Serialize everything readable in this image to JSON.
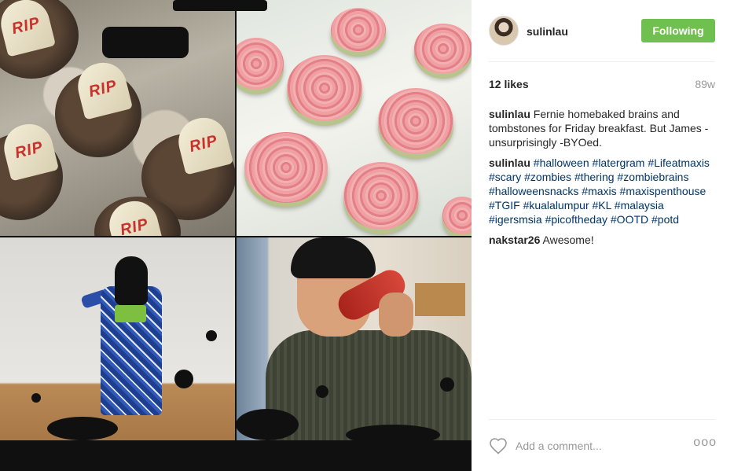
{
  "post": {
    "username": "sulinlau",
    "follow_label": "Following",
    "likes": "12 likes",
    "age": "89w",
    "comments": [
      {
        "user": "sulinlau",
        "text": "Fernie homebaked brains and tombstones for Friday breakfast. But James -unsurprisingly -BYOed."
      },
      {
        "user": "sulinlau",
        "tags": [
          "#halloween",
          "#latergram",
          "#Lifeatmaxis",
          "#scary",
          "#zombies",
          "#thering",
          "#zombiebrains",
          "#halloweensnacks",
          "#maxis",
          "#maxispenthouse",
          "#TGIF",
          "#kualalumpur",
          "#KL",
          "#malaysia",
          "#igersmsia",
          "#picoftheday",
          "#OOTD",
          "#potd"
        ]
      },
      {
        "user": "nakstar26",
        "text": "Awesome!"
      }
    ],
    "comment_placeholder": "Add a comment...",
    "more_label": "ooo"
  },
  "photo": {
    "tombstone_text": "RIP"
  },
  "colors": {
    "follow_button": "#70c050",
    "hashtag": "#003569",
    "muted": "#999999"
  },
  "icons": {
    "like": "heart-outline-icon",
    "options": "more-options-icon"
  }
}
